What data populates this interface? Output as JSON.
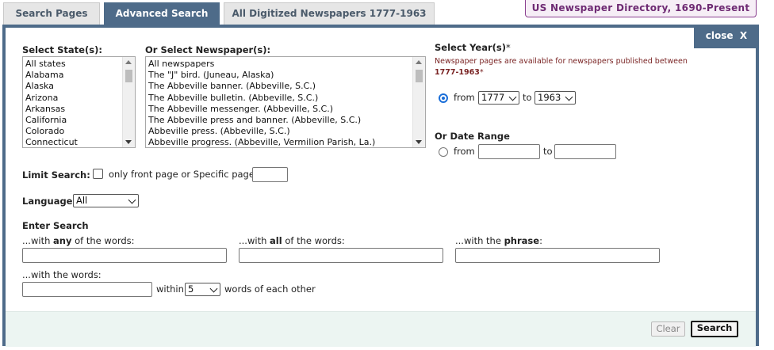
{
  "tabs": [
    {
      "label": "Search Pages",
      "active": false
    },
    {
      "label": "Advanced Search",
      "active": true
    },
    {
      "label": "All Digitized Newspapers 1777-1963",
      "active": false
    }
  ],
  "directory_link": "US Newspaper Directory, 1690-Present",
  "close_label": "close",
  "close_icon": "X",
  "states": {
    "label": "Select State(s):",
    "options": [
      "All states",
      "Alabama",
      "Alaska",
      "Arizona",
      "Arkansas",
      "California",
      "Colorado",
      "Connecticut"
    ]
  },
  "newspapers": {
    "label": "Or Select Newspaper(s):",
    "options": [
      "All newspapers",
      "The \"J\" bird. (Juneau, Alaska)",
      "The Abbeville banner. (Abbeville, S.C.)",
      "The Abbeville bulletin. (Abbeville, S.C.)",
      "The Abbeville messenger. (Abbeville, S.C.)",
      "The Abbeville press and banner. (Abbeville, S.C.)",
      "Abbeville press. (Abbeville, S.C.)",
      "Abbeville progress. (Abbeville, Vermilion Parish, La.)"
    ]
  },
  "years": {
    "label": "Select Year(s)",
    "required_mark": "*",
    "note_line1": "Newspaper pages are available for newspapers published between",
    "note_range": "1777-1963",
    "note_mark": "*",
    "from_label": "from",
    "from_value": "1777",
    "to_label": "to",
    "to_value": "1963"
  },
  "date_range": {
    "label": "Or Date Range",
    "from_label": "from",
    "to_label": "to",
    "from_value": "",
    "to_value": ""
  },
  "limit": {
    "label": "Limit Search:",
    "checkbox_label": "only front page or Specific page",
    "page_value": ""
  },
  "language": {
    "label": "Language",
    "value": "All"
  },
  "enter_search": {
    "label": "Enter Search",
    "any_prefix": "...with ",
    "any_bold": "any",
    "any_suffix": " of the words:",
    "all_prefix": "...with ",
    "all_bold": "all",
    "all_suffix": " of the words:",
    "phrase_prefix": "...with the ",
    "phrase_bold": "phrase",
    "phrase_suffix": ":",
    "words_label": "...with the words:",
    "within_label": "within",
    "within_value": "5",
    "within_suffix": "words of each other"
  },
  "buttons": {
    "clear": "Clear",
    "search": "Search"
  }
}
